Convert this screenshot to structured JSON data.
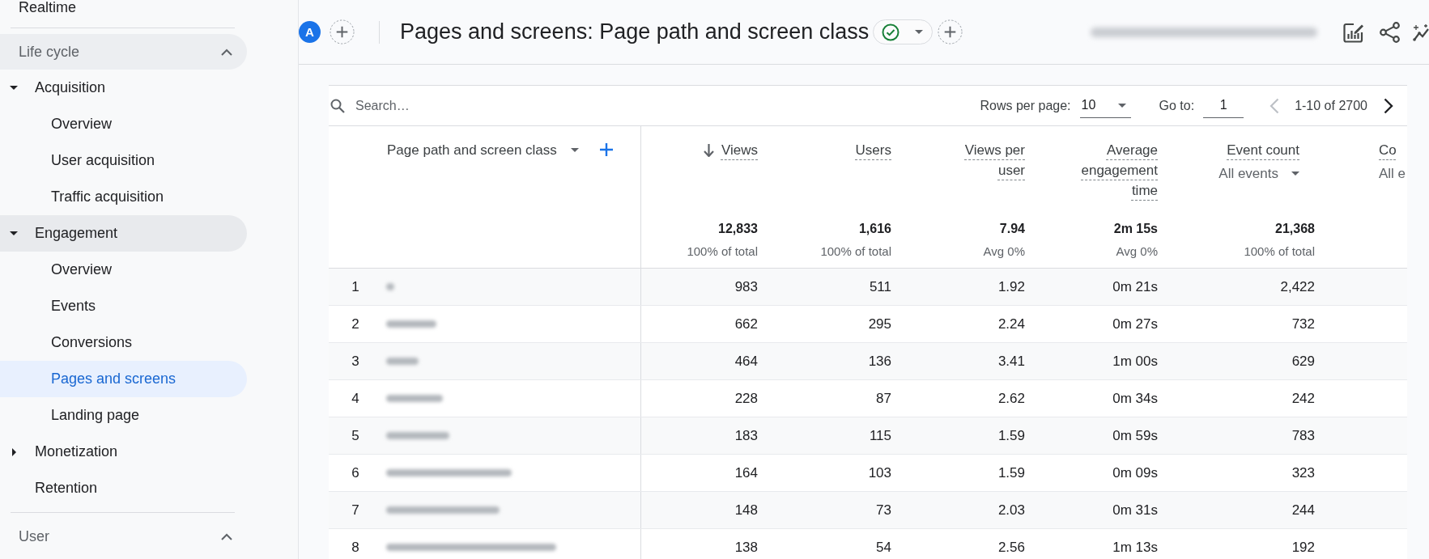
{
  "sidebar": {
    "top_item": "Realtime",
    "sections": [
      {
        "title": "Life cycle",
        "expanded": true,
        "highlighted": true,
        "items": [
          {
            "kind": "group",
            "label": "Acquisition",
            "expanded": true,
            "highlighted": false,
            "children": [
              {
                "label": "Overview",
                "selected": false
              },
              {
                "label": "User acquisition",
                "selected": false
              },
              {
                "label": "Traffic acquisition",
                "selected": false
              }
            ]
          },
          {
            "kind": "group",
            "label": "Engagement",
            "expanded": true,
            "highlighted": true,
            "children": [
              {
                "label": "Overview",
                "selected": false
              },
              {
                "label": "Events",
                "selected": false
              },
              {
                "label": "Conversions",
                "selected": false
              },
              {
                "label": "Pages and screens",
                "selected": true
              },
              {
                "label": "Landing page",
                "selected": false
              }
            ]
          },
          {
            "kind": "group",
            "label": "Monetization",
            "expanded": false,
            "highlighted": false
          },
          {
            "kind": "link",
            "label": "Retention",
            "highlighted": false
          }
        ]
      },
      {
        "title": "User",
        "expanded": true,
        "highlighted": false
      }
    ]
  },
  "header": {
    "avatar": "A",
    "title": "Pages and screens: Page path and screen class"
  },
  "table": {
    "search": {
      "placeholder": "Search…"
    },
    "pagination": {
      "rows_label": "Rows per page:",
      "rows_value": "10",
      "goto_label": "Go to:",
      "goto_value": "1",
      "range": "1-10 of 2700",
      "prev_disabled": true,
      "next_disabled": false
    },
    "dimension": {
      "label": "Page path and screen class"
    },
    "columns": [
      {
        "title": "Views",
        "sorted": true,
        "total": "12,833",
        "total_note": "100% of total"
      },
      {
        "title": "Users",
        "sorted": false,
        "total": "1,616",
        "total_note": "100% of total"
      },
      {
        "title": "Views per user",
        "sorted": false,
        "total": "7.94",
        "total_note": "Avg 0%"
      },
      {
        "title": "Average engagement time",
        "sorted": false,
        "total": "2m 15s",
        "total_note": "Avg 0%"
      },
      {
        "title": "Event count",
        "sorted": false,
        "subtitle": "All events",
        "total": "21,368",
        "total_note": "100% of total"
      },
      {
        "title": "Co",
        "sorted": false,
        "subtitle": "All e"
      }
    ],
    "rows": [
      {
        "index": "1",
        "values": [
          "983",
          "511",
          "1.92",
          "0m 21s",
          "2,422"
        ]
      },
      {
        "index": "2",
        "values": [
          "662",
          "295",
          "2.24",
          "0m 27s",
          "732"
        ]
      },
      {
        "index": "3",
        "values": [
          "464",
          "136",
          "3.41",
          "1m 00s",
          "629"
        ]
      },
      {
        "index": "4",
        "values": [
          "228",
          "87",
          "2.62",
          "0m 34s",
          "242"
        ]
      },
      {
        "index": "5",
        "values": [
          "183",
          "115",
          "1.59",
          "0m 59s",
          "783"
        ]
      },
      {
        "index": "6",
        "values": [
          "164",
          "103",
          "1.59",
          "0m 09s",
          "323"
        ]
      },
      {
        "index": "7",
        "values": [
          "148",
          "73",
          "2.03",
          "0m 31s",
          "244"
        ]
      },
      {
        "index": "8",
        "values": [
          "138",
          "54",
          "2.56",
          "1m 13s",
          "192"
        ]
      }
    ]
  }
}
